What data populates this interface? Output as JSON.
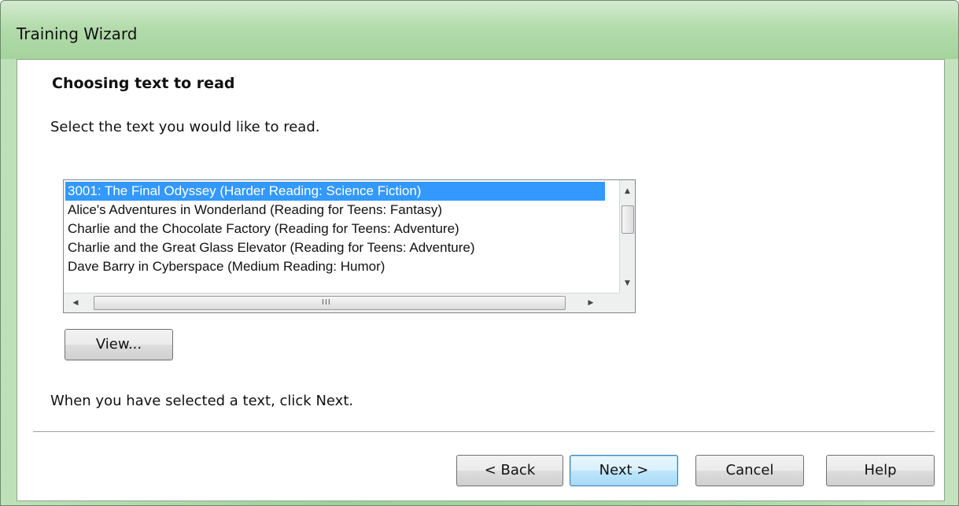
{
  "window": {
    "title": "Training Wizard"
  },
  "page": {
    "heading": "Choosing text to read",
    "instruction": "Select the text you would like to read.",
    "finish_hint": "When you have selected a text, click Next."
  },
  "text_list": {
    "selected_index": 0,
    "items": [
      "3001: The Final Odyssey (Harder Reading: Science Fiction)",
      "Alice's Adventures in Wonderland (Reading for Teens: Fantasy)",
      "Charlie and the Chocolate Factory (Reading for Teens: Adventure)",
      "Charlie and the Great Glass Elevator (Reading for Teens: Adventure)",
      "Dave Barry in Cyberspace (Medium Reading: Humor)"
    ],
    "scroll_up_glyph": "▲",
    "scroll_down_glyph": "▼",
    "scroll_left_glyph": "◀",
    "scroll_right_glyph": "▶",
    "hscroll_grip": "III"
  },
  "buttons": {
    "view": "View...",
    "back": "< Back",
    "next": "Next >",
    "cancel": "Cancel",
    "help": "Help"
  },
  "colors": {
    "selection": "#3399ff",
    "titlebar": "#a4d39c"
  }
}
